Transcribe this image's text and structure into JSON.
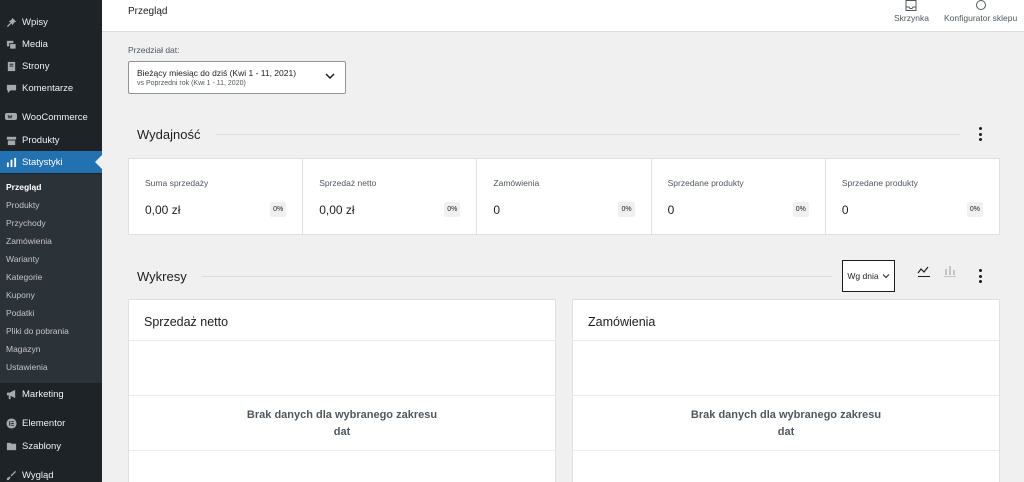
{
  "sidebar": {
    "menu": [
      {
        "label": "Wpisy",
        "icon": "pin-icon"
      },
      {
        "label": "Media",
        "icon": "media-icon"
      },
      {
        "label": "Strony",
        "icon": "page-icon"
      },
      {
        "label": "Komentarze",
        "icon": "comment-icon"
      },
      {
        "label": "WooCommerce",
        "icon": "woocommerce-icon"
      },
      {
        "label": "Produkty",
        "icon": "archive-icon"
      },
      {
        "label": "Statystyki",
        "icon": "bar-chart-icon"
      },
      {
        "label": "Marketing",
        "icon": "megaphone-icon"
      },
      {
        "label": "Elementor",
        "icon": "elementor-icon"
      },
      {
        "label": "Szablony",
        "icon": "folder-icon"
      },
      {
        "label": "Wygląd",
        "icon": "brush-icon"
      }
    ],
    "submenu": [
      "Przegląd",
      "Produkty",
      "Przychody",
      "Zamówienia",
      "Warianty",
      "Kategorie",
      "Kupony",
      "Podatki",
      "Pliki do pobrania",
      "Magazyn",
      "Ustawienia"
    ]
  },
  "header": {
    "title": "Przegląd",
    "inbox_label": "Skrzynka",
    "setup_label": "Konfigurator sklepu"
  },
  "date_range": {
    "label": "Przedział dat:",
    "main": "Bieżący miesiąc do dziś (Kwi 1 - 11, 2021)",
    "compare": "vs Poprzedni rok (Kwi 1 - 11, 2020)"
  },
  "performance": {
    "title": "Wydajność",
    "stats": [
      {
        "label": "Suma sprzedaży",
        "value": "0,00 zł",
        "delta": "0%"
      },
      {
        "label": "Sprzedaż netto",
        "value": "0,00 zł",
        "delta": "0%"
      },
      {
        "label": "Zamówienia",
        "value": "0",
        "delta": "0%"
      },
      {
        "label": "Sprzedane produkty",
        "value": "0",
        "delta": "0%"
      },
      {
        "label": "Sprzedane produkty",
        "value": "0",
        "delta": "0%"
      }
    ]
  },
  "charts": {
    "title": "Wykresy",
    "interval": "Wg dnia",
    "panels": [
      {
        "title": "Sprzedaż netto",
        "empty_line1": "Brak danych dla wybranego zakresu",
        "empty_line2": "dat"
      },
      {
        "title": "Zamówienia",
        "empty_line1": "Brak danych dla wybranego zakresu",
        "empty_line2": "dat"
      }
    ]
  },
  "colors": {
    "sidebar_bg": "#1d2327",
    "submenu_bg": "#2c3338",
    "accent": "#2271b1"
  }
}
